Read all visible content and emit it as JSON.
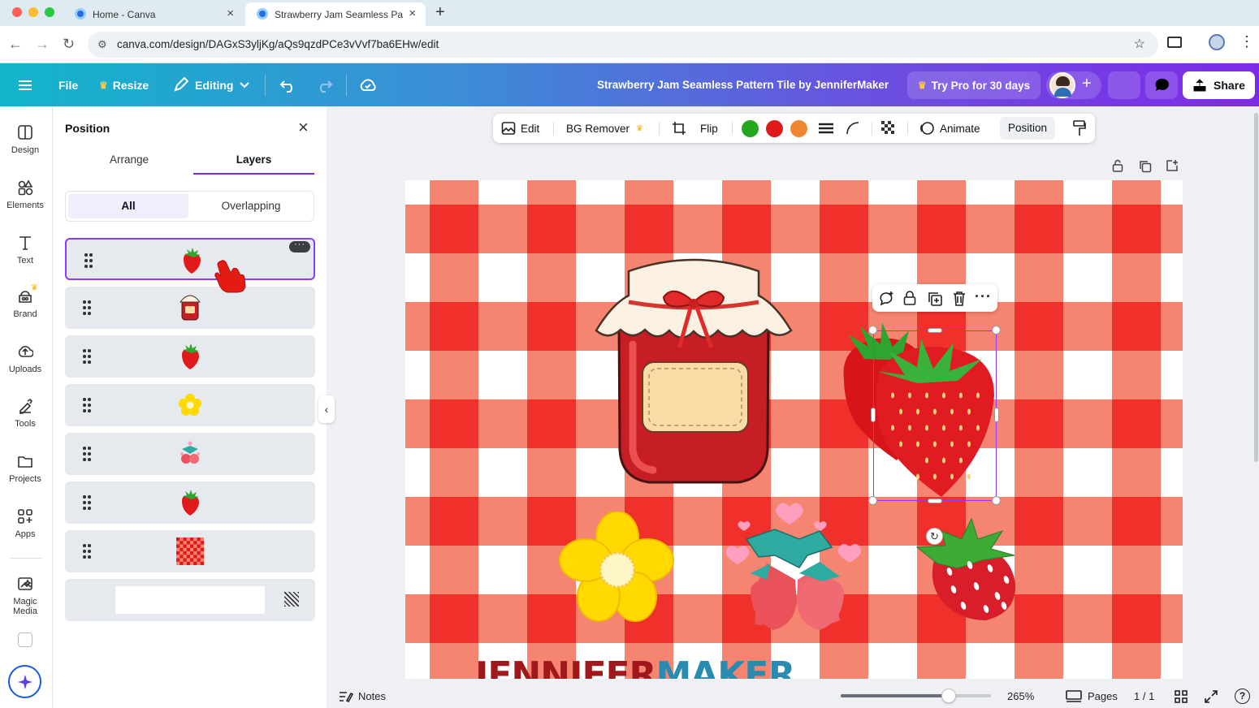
{
  "browser": {
    "tabs": [
      {
        "title": "Home - Canva"
      },
      {
        "title": "Strawberry Jam Seamless Pa"
      }
    ],
    "url": "canva.com/design/DAGxS3yljKg/aQs9qzdPCe3vVvf7ba6EHw/edit"
  },
  "topbar": {
    "file_label": "File",
    "resize_label": "Resize",
    "editing_label": "Editing",
    "doc_title": "Strawberry Jam Seamless Pattern Tile by JenniferMaker",
    "try_pro_label": "Try Pro for 30 days",
    "share_label": "Share"
  },
  "rail": {
    "items": [
      {
        "label": "Design",
        "icon": "design-icon"
      },
      {
        "label": "Elements",
        "icon": "elements-icon"
      },
      {
        "label": "Text",
        "icon": "text-icon"
      },
      {
        "label": "Brand",
        "icon": "brand-icon"
      },
      {
        "label": "Uploads",
        "icon": "uploads-icon"
      },
      {
        "label": "Tools",
        "icon": "tools-icon"
      },
      {
        "label": "Projects",
        "icon": "projects-icon"
      },
      {
        "label": "Apps",
        "icon": "apps-icon"
      },
      {
        "label": "Magic Media",
        "icon": "magic-media-icon"
      }
    ]
  },
  "panel": {
    "title": "Position",
    "tabs": [
      {
        "label": "Arrange"
      },
      {
        "label": "Layers"
      }
    ],
    "active_tab": "Layers",
    "filters": [
      {
        "label": "All"
      },
      {
        "label": "Overlapping"
      }
    ],
    "active_filter": "All",
    "layers": [
      {
        "thumb": "strawberry",
        "selected": true
      },
      {
        "thumb": "jam-jar",
        "selected": false
      },
      {
        "thumb": "strawberry",
        "selected": false
      },
      {
        "thumb": "flower",
        "selected": false
      },
      {
        "thumb": "strawberries-hearts",
        "selected": false
      },
      {
        "thumb": "strawberry",
        "selected": false
      },
      {
        "thumb": "gingham",
        "selected": false
      },
      {
        "thumb": "background",
        "selected": false
      }
    ]
  },
  "context_toolbar": {
    "edit_label": "Edit",
    "bg_remover_label": "BG Remover",
    "flip_label": "Flip",
    "colors": [
      "#21a81f",
      "#e0191a",
      "#f0862e"
    ],
    "animate_label": "Animate",
    "position_label": "Position"
  },
  "canvas": {
    "gingham_colors": {
      "light": "#f58470",
      "dark": "#f0302a",
      "white": "#ffffff"
    },
    "watermark_part1": "JENNIFER",
    "watermark_part2": "MAKER"
  },
  "bottom": {
    "notes_label": "Notes",
    "zoom_value": 0.72,
    "zoom_label": "265%",
    "pages_label": "Pages",
    "page_count": "1 / 1"
  },
  "accent": "#7d2ae8"
}
